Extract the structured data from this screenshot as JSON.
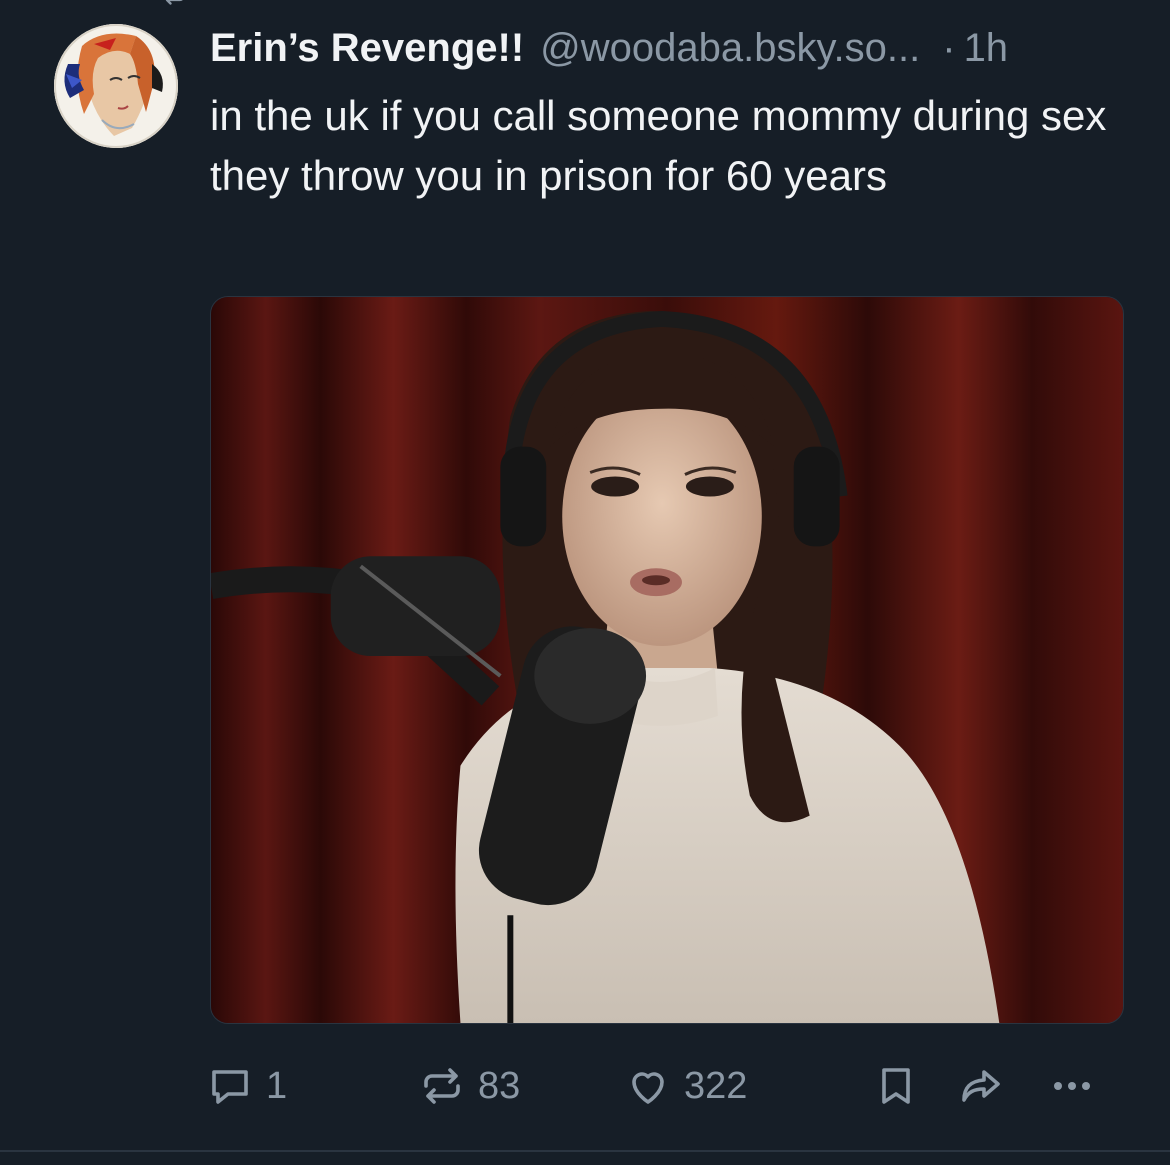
{
  "post": {
    "author_name": "Erin’s Revenge!!",
    "author_handle": "@woodaba.bsky.so...",
    "separator": "·",
    "timestamp": "1h",
    "text": "in the uk if you call someone mommy during sex they throw you in prison for 60 years"
  },
  "actions": {
    "reply_count": "1",
    "repost_count": "83",
    "like_count": "322"
  },
  "icons": {
    "reply": "speech-bubble-icon",
    "repost": "repost-arrows-icon",
    "like": "heart-icon",
    "bookmark": "bookmark-icon",
    "share": "share-arrow-icon",
    "more": "more-dots-icon"
  },
  "colors": {
    "background": "#161e27",
    "text_primary": "#f1f3f5",
    "text_secondary": "#8b98a5"
  }
}
